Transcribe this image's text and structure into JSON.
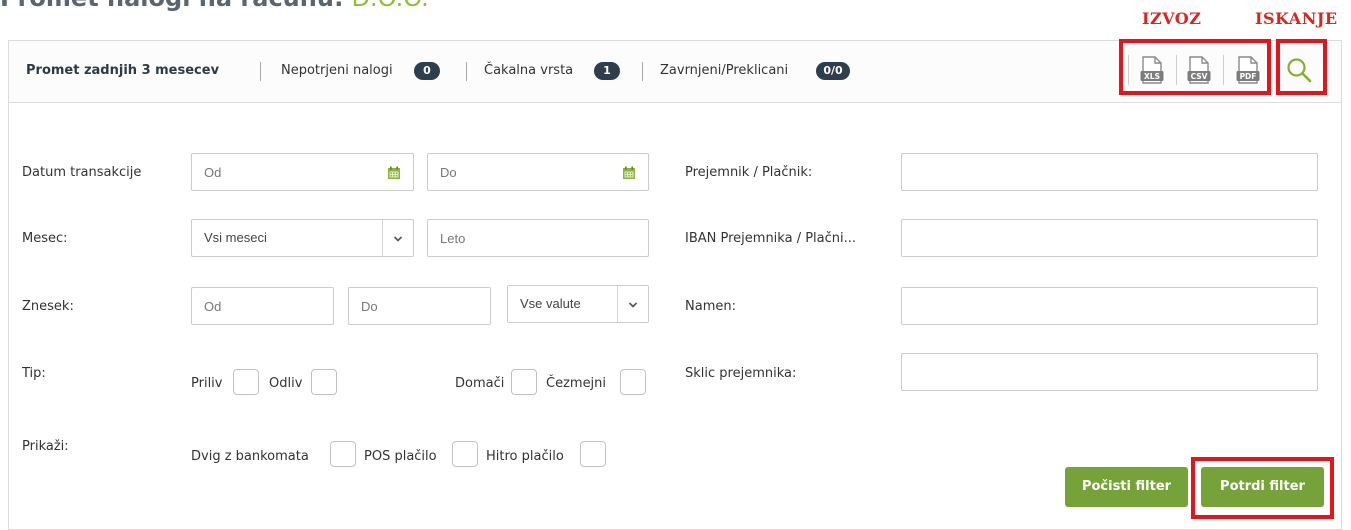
{
  "page": {
    "title": "Promet nalogi na računu:",
    "company": "D.O.O."
  },
  "annotations": {
    "export": "IZVOZ",
    "search": "ISKANJE"
  },
  "tabs": [
    {
      "label": "Promet zadnjih 3 mesecev",
      "active": true
    },
    {
      "label": "Nepotrjeni nalogi",
      "badge": "0"
    },
    {
      "label": "Čakalna vrsta",
      "badge": "1"
    },
    {
      "label": "Zavrnjeni/Preklicani",
      "badge": "0/0"
    }
  ],
  "export": {
    "xls": "XLS",
    "csv": "CSV",
    "pdf": "PDF"
  },
  "filters": {
    "date_label": "Datum transakcije",
    "date_from_placeholder": "Od",
    "date_to_placeholder": "Do",
    "month_label": "Mesec:",
    "month_value": "Vsi meseci",
    "year_placeholder": "Leto",
    "amount_label": "Znesek:",
    "amount_from_placeholder": "Od",
    "amount_to_placeholder": "Do",
    "currency_value": "Vse valute",
    "type_label": "Tip:",
    "type_options": [
      "Priliv",
      "Odliv",
      "Domači",
      "Čezmejni"
    ],
    "show_label": "Prikaži:",
    "show_options": [
      "Dvig z bankomata",
      "POS plačilo",
      "Hitro plačilo"
    ],
    "payee_label": "Prejemnik / Plačnik:",
    "iban_label": "IBAN Prejemnika / Plačni...",
    "purpose_label": "Namen:",
    "reference_label": "Sklic prejemnika:"
  },
  "buttons": {
    "clear": "Počisti filter",
    "confirm": "Potrdi filter"
  },
  "colors": {
    "accent_green": "#76a23a",
    "annotation_red": "#e3141b",
    "badge_dark": "#2f3e4c"
  },
  "icons": [
    "xls-file-icon",
    "csv-file-icon",
    "pdf-file-icon",
    "search-icon",
    "calendar-icon",
    "chevron-down-icon"
  ]
}
